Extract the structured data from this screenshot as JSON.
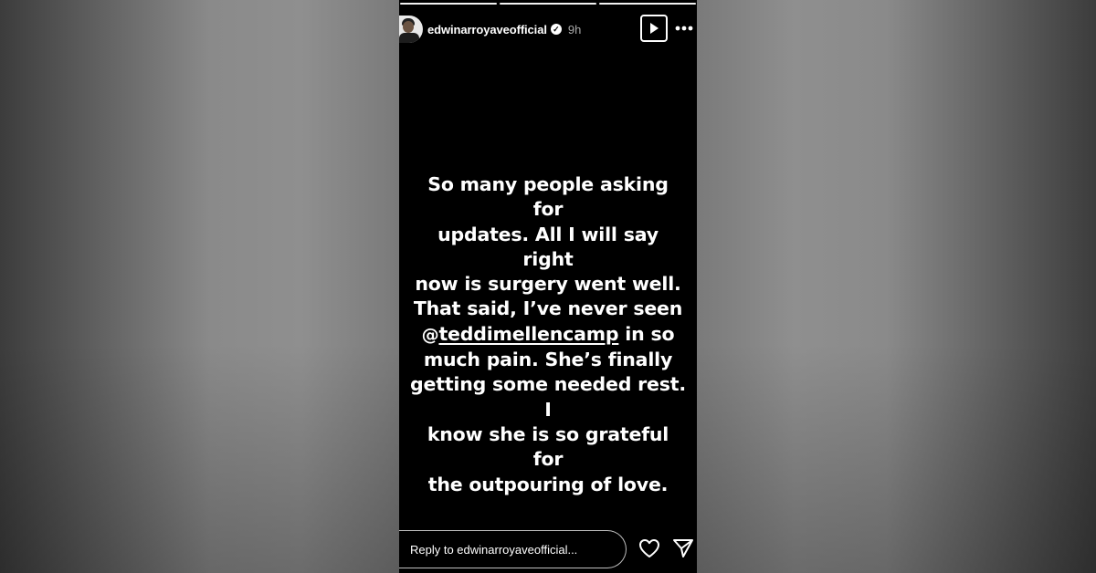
{
  "story": {
    "username": "edwinarroyaveofficial",
    "verified_mark": "✓",
    "time_ago": "9h",
    "progress_segments": 3,
    "text": {
      "line1": "So many people asking for",
      "line2": "updates. All I will say right",
      "line3": "now is surgery went well.",
      "line4": "That said, I’ve never seen",
      "mention_prefix": "@",
      "mention": "teddimellencamp",
      "line5_rest": " in so",
      "line6": "much pain. She’s finally",
      "line7": "getting some needed rest. I",
      "line8": "know she is so grateful for",
      "line9": "the outpouring of love."
    },
    "reply_placeholder": "Reply to edwinarroyaveofficial..."
  },
  "icons": {
    "play": "play-icon",
    "more": "more-icon",
    "heart": "heart-icon",
    "send": "send-icon",
    "verified": "verified-icon"
  },
  "colors": {
    "story_background": "#000000",
    "text": "#ffffff",
    "backdrop": "#7a7a7a"
  }
}
